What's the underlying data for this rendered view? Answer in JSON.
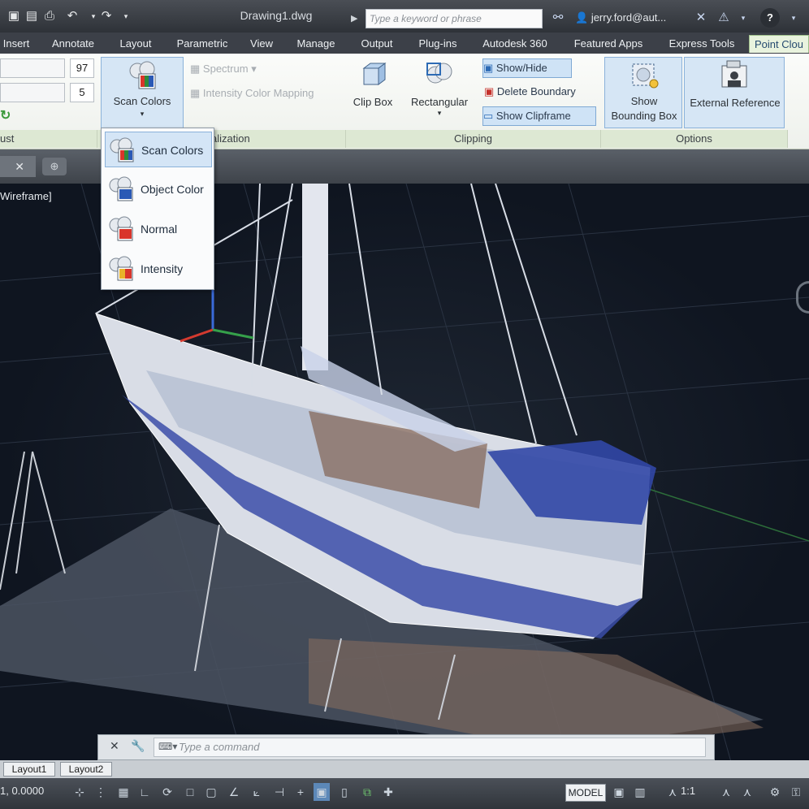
{
  "titlebar": {
    "document_title": "Drawing1.dwg",
    "search_placeholder": "Type a keyword or phrase",
    "user": "jerry.ford@aut...",
    "help_label": "?"
  },
  "ribbon_tabs": [
    "Insert",
    "Annotate",
    "Layout",
    "Parametric",
    "View",
    "Manage",
    "Output",
    "Plug-ins",
    "Autodesk 360",
    "Featured Apps",
    "Express Tools",
    "Point Clou"
  ],
  "ribbon": {
    "adjust": {
      "value_top": "97",
      "value_bottom": "5",
      "panel_title": "ust"
    },
    "visualization": {
      "scan_colors_label": "Scan Colors",
      "spectrum_label": "Spectrum",
      "intensity_mapping_label": "Intensity Color Mapping",
      "panel_title": "alization"
    },
    "clipping": {
      "clip_box_label": "Clip Box",
      "rectangular_label": "Rectangular",
      "show_hide_label": "Show/Hide",
      "delete_boundary_label": "Delete Boundary",
      "show_clipframe_label": "Show Clipframe",
      "panel_title": "Clipping"
    },
    "options": {
      "show_bounding_box_label_1": "Show",
      "show_bounding_box_label_2": "Bounding Box",
      "external_reference_label": "External Reference",
      "panel_title": "Options"
    }
  },
  "dropdown": {
    "items": [
      {
        "label": "Scan Colors",
        "icon": "scan-colors-icon"
      },
      {
        "label": "Object Color",
        "icon": "object-color-icon"
      },
      {
        "label": "Normal",
        "icon": "normal-icon"
      },
      {
        "label": "Intensity",
        "icon": "intensity-icon"
      }
    ]
  },
  "viewport": {
    "label": "Wireframe]"
  },
  "command_line": {
    "placeholder": "Type a command"
  },
  "layout_tabs": [
    "Layout1",
    "Layout2"
  ],
  "status": {
    "coords": "1, 0.0000",
    "model_label": "MODEL",
    "scale": "1:1"
  },
  "colors": {
    "accent_tab": "#e9f3de",
    "panel_title_bg": "#dde8d3",
    "viewport_bg": "#0f1520"
  }
}
